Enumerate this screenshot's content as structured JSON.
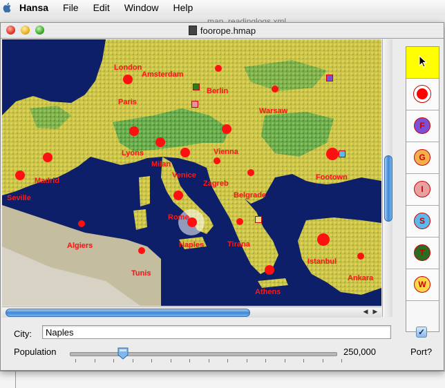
{
  "menubar": {
    "app": "Hansa",
    "items": [
      "File",
      "Edit",
      "Window",
      "Help"
    ]
  },
  "background_window": {
    "title": "map_readinglogs.xml"
  },
  "window": {
    "title": "foorope.hmap"
  },
  "map": {
    "cities": [
      {
        "name": "London"
      },
      {
        "name": "Amsterdam"
      },
      {
        "name": "Paris"
      },
      {
        "name": "Berlin"
      },
      {
        "name": "Warsaw"
      },
      {
        "name": "Lyons"
      },
      {
        "name": "Milan"
      },
      {
        "name": "Vienna"
      },
      {
        "name": "Venice"
      },
      {
        "name": "Zagreb"
      },
      {
        "name": "Madrid"
      },
      {
        "name": "Seville"
      },
      {
        "name": "Footown"
      },
      {
        "name": "Belgrade"
      },
      {
        "name": "Rome"
      },
      {
        "name": "Naples"
      },
      {
        "name": "Algiers"
      },
      {
        "name": "Tirana"
      },
      {
        "name": "Tunis"
      },
      {
        "name": "Istanbul"
      },
      {
        "name": "Ankara"
      },
      {
        "name": "Athens"
      }
    ],
    "selected_city": "Naples"
  },
  "tools": [
    {
      "name": "pointer",
      "letter": ""
    },
    {
      "name": "city",
      "letter": ""
    },
    {
      "name": "F",
      "letter": "F",
      "color": "#7b4fd6"
    },
    {
      "name": "G",
      "letter": "G",
      "color": "#f2b04a"
    },
    {
      "name": "I",
      "letter": "I",
      "color": "#e8a0a0"
    },
    {
      "name": "S",
      "letter": "S",
      "color": "#5db8ec"
    },
    {
      "name": "T",
      "letter": "T",
      "color": "#2c6b22"
    },
    {
      "name": "W",
      "letter": "W",
      "color": "#ffd84a"
    }
  ],
  "controls": {
    "city_label": "City:",
    "city_value": "Naples",
    "population_label": "Population",
    "population_value": "250,000",
    "population_fraction": 0.2,
    "port_label": "Port?",
    "port_checked": true,
    "check_mark": "✓"
  },
  "colors": {
    "city_red": "#ff1010",
    "sea": "#0e1f6a",
    "active_tool": "#ffff00",
    "scroll_blue": "#3d86d6"
  }
}
